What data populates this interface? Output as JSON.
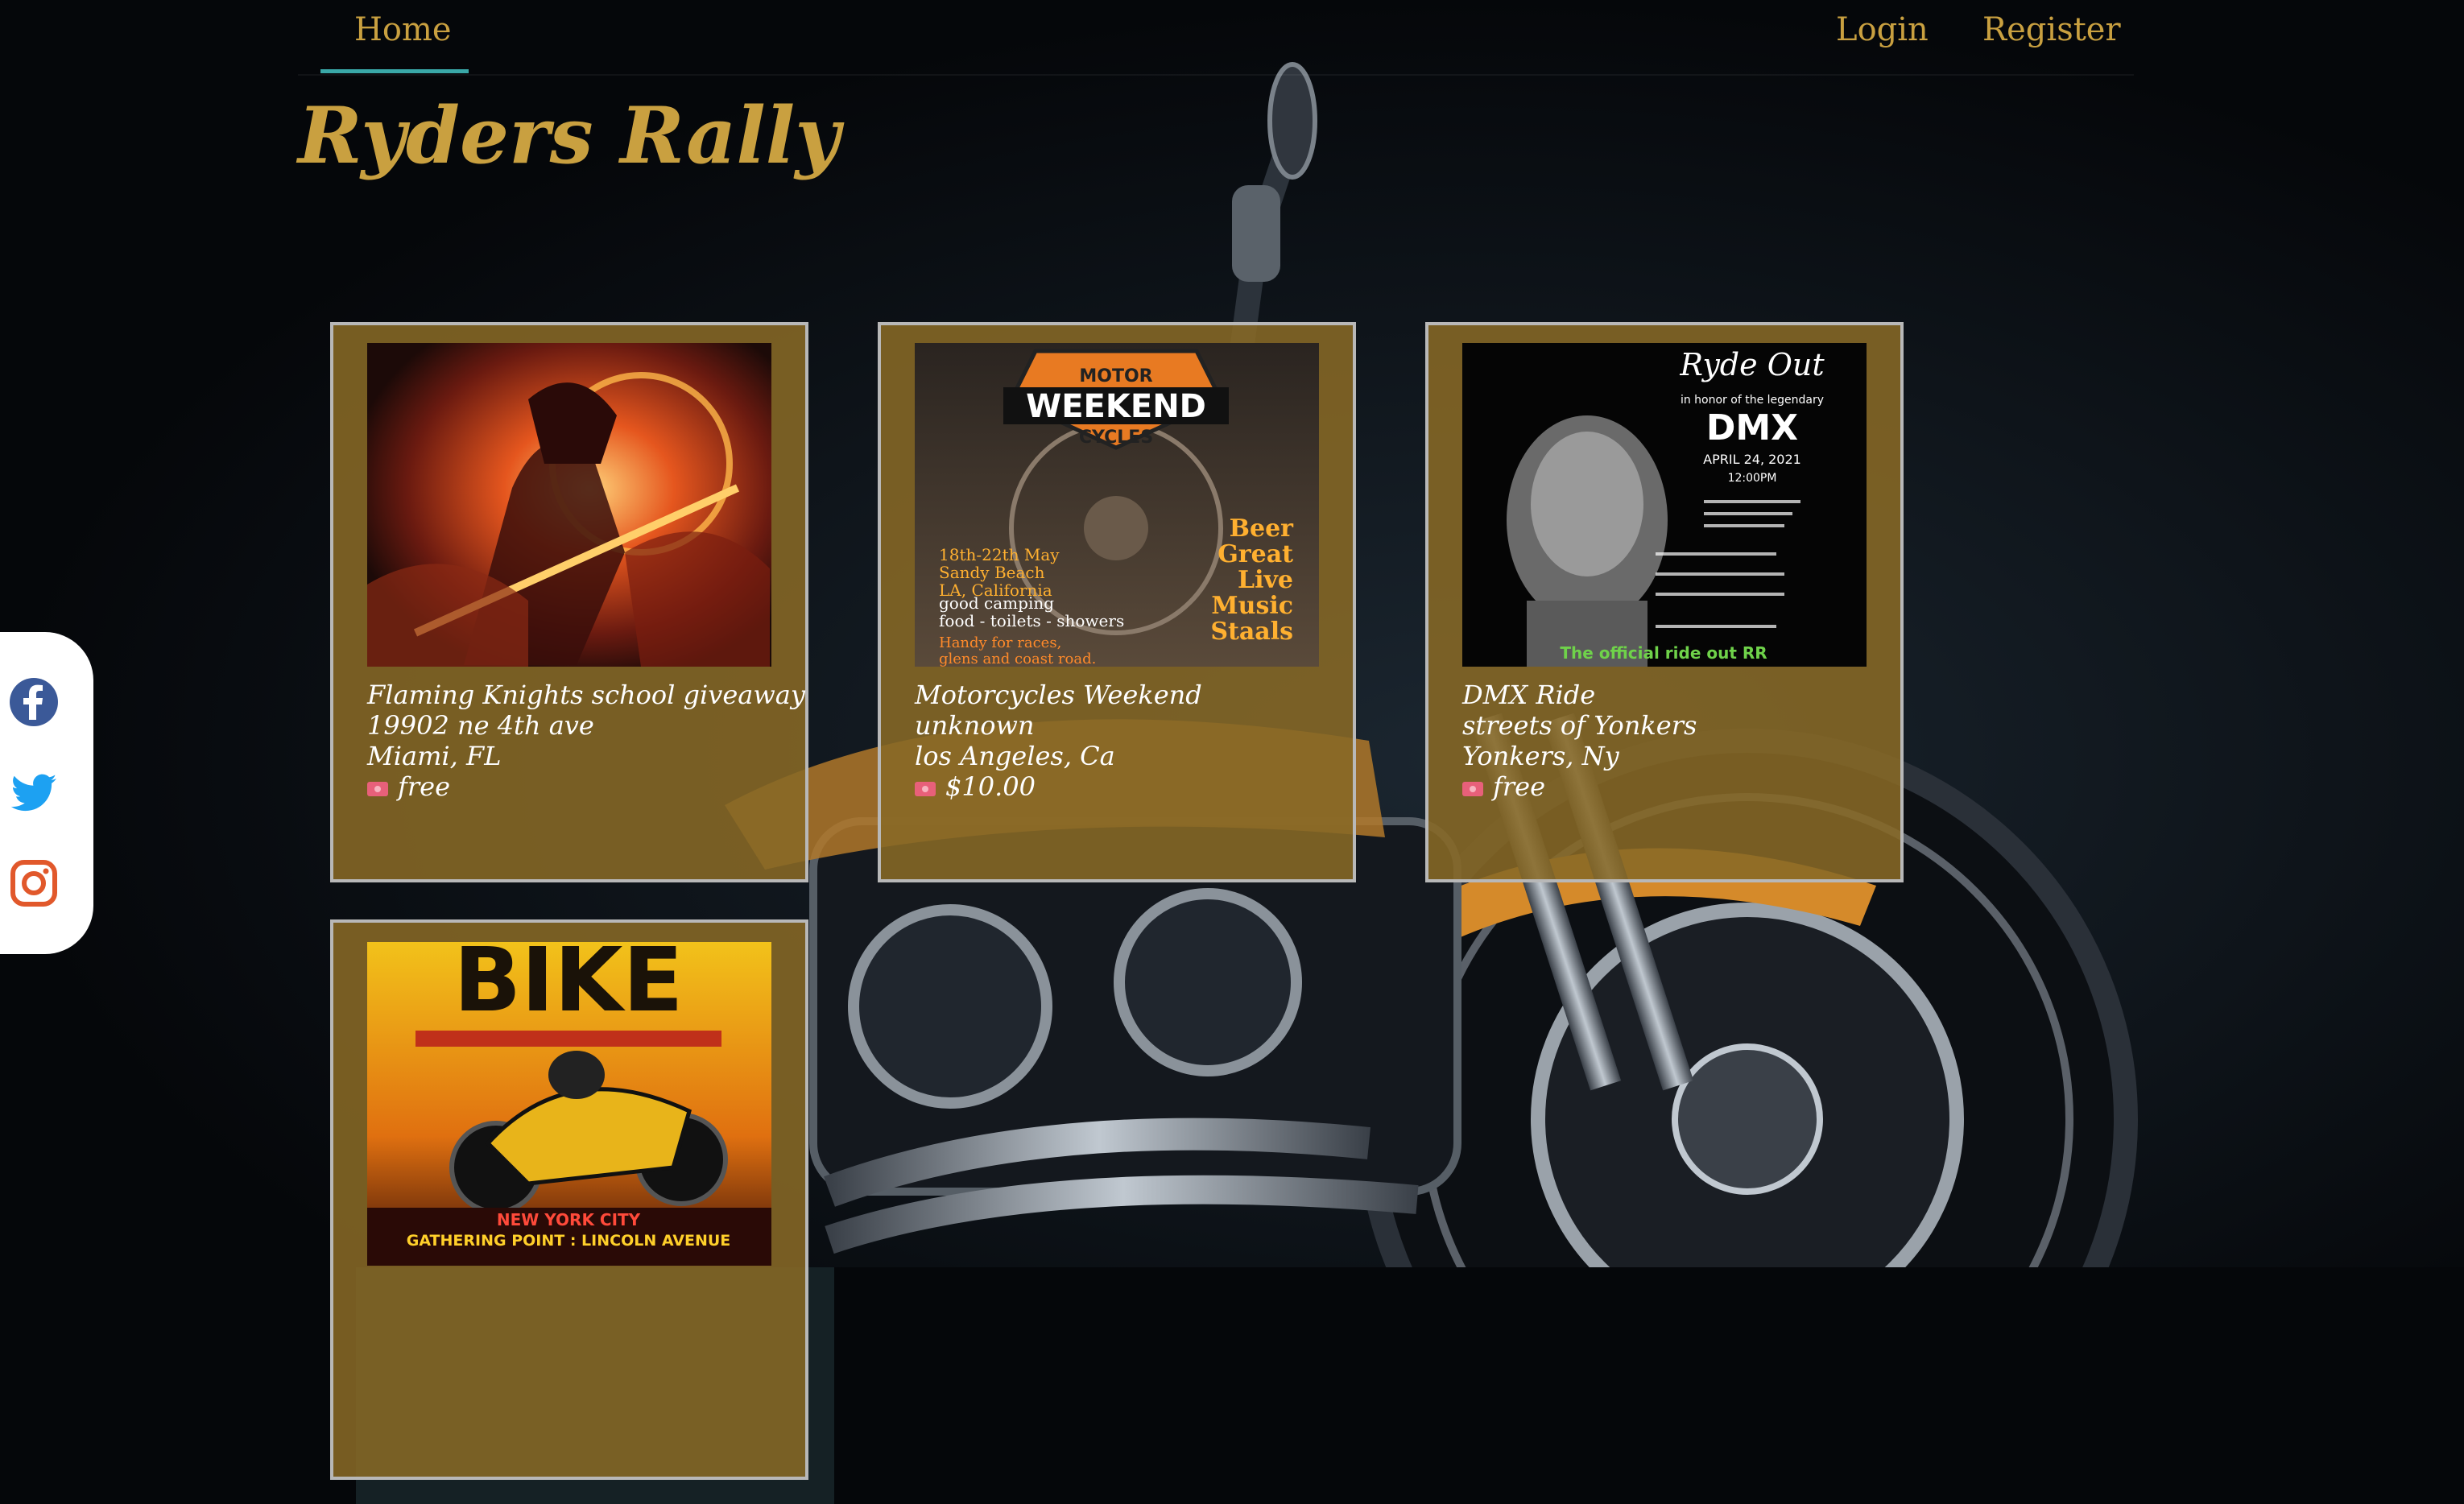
{
  "nav": {
    "home": "Home",
    "login": "Login",
    "register": "Register"
  },
  "site": {
    "title": "Ryders Rally"
  },
  "social": {
    "icons": [
      "facebook-icon",
      "twitter-icon",
      "instagram-icon"
    ]
  },
  "events": [
    {
      "name": "Flaming Knights school giveaway",
      "address": "19902 ne 4th ave",
      "city": "Miami, FL",
      "price": "free"
    },
    {
      "name": "Motorcycles Weekend",
      "address": "unknown",
      "city": "los Angeles, Ca",
      "price": "$10.00",
      "poster": {
        "badge": "MOTOR WEEKEND CYCLES",
        "dates": "18th-22th May Sandy Beach LA, California",
        "amenities": "good camping food - toilets - showers",
        "races": "Handy for races, glens and coast road.",
        "side": "Beer Great Live Music Staals"
      }
    },
    {
      "name": "DMX Ride",
      "address": "streets of Yonkers",
      "city": "Yonkers, Ny",
      "price": "free",
      "poster": {
        "header": "Ryde Out",
        "sub": "in honor of the legendary",
        "name": "DMX",
        "date": "APRIL 24, 2021",
        "time": "12:00PM",
        "footer": "The official ride out RR"
      }
    },
    {
      "poster": {
        "title": "BIKE",
        "city": "NEW YORK CITY",
        "gathering": "GATHERING POINT : LINCOLN AVENUE"
      }
    }
  ],
  "colors": {
    "accent": "#c9a040",
    "card": "#876926",
    "underline": "#3aa8a8",
    "background": "#05070a"
  }
}
